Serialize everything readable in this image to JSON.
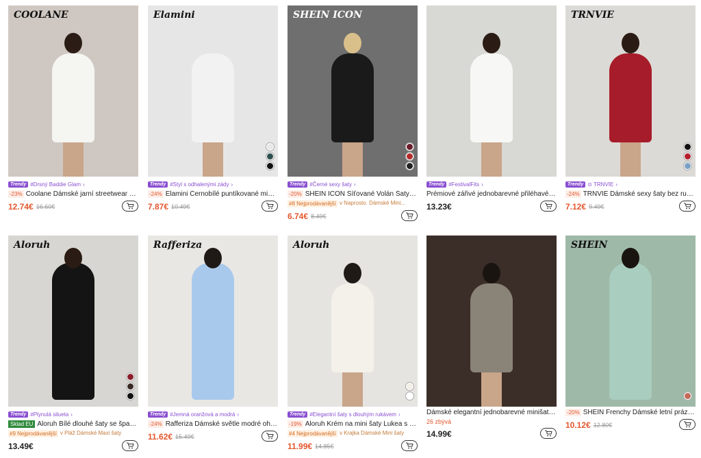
{
  "products": [
    {
      "brand": "COOLANE",
      "trend_badge": "Trendy",
      "trend": "#Drsný Baddie Glam",
      "discount": "-23%",
      "title": "Coolane Dámské jarní streetwear hip...",
      "price": "12.74€",
      "old_price": "16.60€",
      "colors": {
        "bg": "#cfc8c2",
        "dress": "#f5f5f2",
        "hair": "#2b1d16"
      }
    },
    {
      "brand": "Elamini",
      "trend_badge": "Trendy",
      "trend": "#Styl s odhalenými zády",
      "discount": "-24%",
      "title": "Elamini Černobílé puntíkované mini š...",
      "price": "7.87€",
      "old_price": "10.49€",
      "swatches": [
        "#e8e8e8",
        "#2f4f4f",
        "#111111"
      ],
      "colors": {
        "bg": "#e6e6e6",
        "dress": "#f2f2f2",
        "hair": ""
      }
    },
    {
      "brand": "SHEIN ICON",
      "trend_badge": "Trendy",
      "trend": "#Černé sexy šaty",
      "discount": "-20%",
      "title": "SHEIN ICON Síťované Volán Šaty na ...",
      "rank_badge": "#8 Nejprodávanější",
      "rank_cat": "v Naprosto. Dámské Mini...",
      "price": "6.74€",
      "old_price": "8.49€",
      "swatches": [
        "#6b1d2a",
        "#b32b2b",
        "#222222"
      ],
      "colors": {
        "bg": "#6f6f6f",
        "dress": "#1a1a1a",
        "hair": "#d9c08a"
      }
    },
    {
      "brand": "",
      "trend_badge": "Trendy",
      "trend": "#FestivalFits",
      "discount": "",
      "title": "Prémiové zářivé jednobarevné přiléhavé šat...",
      "price": "13.23€",
      "old_price": "",
      "colors": {
        "bg": "#d8d8d4",
        "dress": "#f7f7f5",
        "hair": "#2a1c14"
      }
    },
    {
      "brand": "TRNVIE",
      "trend_badge": "Trendy",
      "trend": "⊙ TRNVIE",
      "discount": "-24%",
      "title": "TRNVIE Dámské sexy šaty bez rukáv...",
      "price": "7.12€",
      "old_price": "9.49€",
      "swatches": [
        "#111111",
        "#b51f2e",
        "#7aa0c8"
      ],
      "colors": {
        "bg": "#dcdad6",
        "dress": "#a71c2a",
        "hair": "#2a1c14"
      }
    },
    {
      "brand": "Aloruh",
      "trend_badge": "Trendy",
      "trend": "#Plynulá silueta",
      "sklad": "Sklad EU",
      "discount": "",
      "title": "Aloruh Bílé dlouhé šaty se špaget...",
      "rank_badge": "#9 Nejprodávanější",
      "rank_cat": "v Pláž Dámské Maxi šaty",
      "price": "13.49€",
      "old_price": "",
      "swatches": [
        "#8b1e2a",
        "#3a2a24",
        "#111111"
      ],
      "colors": {
        "bg": "#d8d6d2",
        "dress": "#141414",
        "hair": "#2a1c14"
      }
    },
    {
      "brand": "Rafferiza",
      "trend_badge": "Trendy",
      "trend": "#Jemná oranžová a modrá",
      "discount": "-24%",
      "title": "Rafferiza Dámské světle modré ohláv...",
      "price": "11.62€",
      "old_price": "15.49€",
      "colors": {
        "bg": "#e9e7e4",
        "dress": "#a9c9ec",
        "hair": "#1f1a16"
      }
    },
    {
      "brand": "Aloruh",
      "trend_badge": "Trendy",
      "trend": "#Elegantní šaty s dlouhým rukávem",
      "discount": "-19%",
      "title": "Aloruh Krém na mini šaty Lukea s dl...",
      "rank_badge": "#4 Nejprodávanější",
      "rank_cat": "v Krajka Dámské Mini šaty",
      "price": "11.99€",
      "old_price": "14.85€",
      "swatches": [
        "#f2efe8",
        "#ffffff"
      ],
      "colors": {
        "bg": "#e6e4e0",
        "dress": "#f4f1ea",
        "hair": "#1f1a16"
      }
    },
    {
      "brand": "",
      "trend_badge": "",
      "trend": "",
      "discount": "",
      "title": "Dámské elegantní jednobarevné minišaty s ...",
      "stock": "26 zbývá",
      "price": "14.99€",
      "old_price": "",
      "colors": {
        "bg": "#3b2e28",
        "dress": "#8a8478",
        "hair": "#1a1410"
      }
    },
    {
      "brand": "SHEIN",
      "trend_badge": "",
      "trend": "",
      "discount": "-20%",
      "title": "SHEIN Frenchy Dámské letní prázdni...",
      "price": "10.12€",
      "old_price": "12.80€",
      "swatches": [
        "#c46a5a"
      ],
      "colors": {
        "bg": "#9fb9a8",
        "dress": "#a9cdbf",
        "hair": "#1a1410"
      }
    }
  ]
}
